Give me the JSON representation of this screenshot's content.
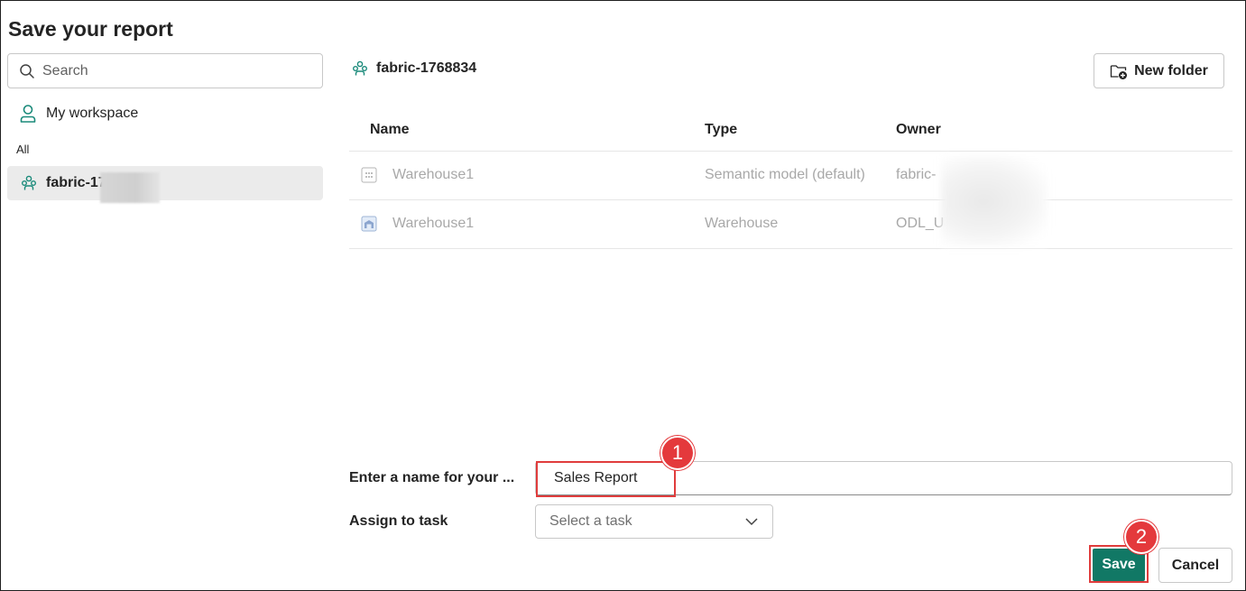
{
  "dialog": {
    "title": "Save your report"
  },
  "sidebar": {
    "search_placeholder": "Search",
    "my_workspace": "My workspace",
    "section_label": "All",
    "workspace_item": "fabric-17"
  },
  "main": {
    "workspace_name": "fabric-1768834",
    "new_folder_label": "New folder",
    "columns": [
      "Name",
      "Type",
      "Owner"
    ],
    "rows": [
      {
        "name": "Warehouse1",
        "type": "Semantic model (default)",
        "owner": "fabric-",
        "icon": "semantic-model-icon"
      },
      {
        "name": "Warehouse1",
        "type": "Warehouse",
        "owner": "ODL_U",
        "icon": "warehouse-icon"
      }
    ]
  },
  "form": {
    "name_label": "Enter a name for your ...",
    "name_value": "Sales Report",
    "task_label": "Assign to task",
    "task_placeholder": "Select a task"
  },
  "actions": {
    "save": "Save",
    "cancel": "Cancel"
  },
  "annotations": {
    "step1": "1",
    "step2": "2"
  },
  "colors": {
    "accent": "#117865",
    "highlight": "#e03c3c",
    "workspace_icon": "#1a8a7a"
  }
}
